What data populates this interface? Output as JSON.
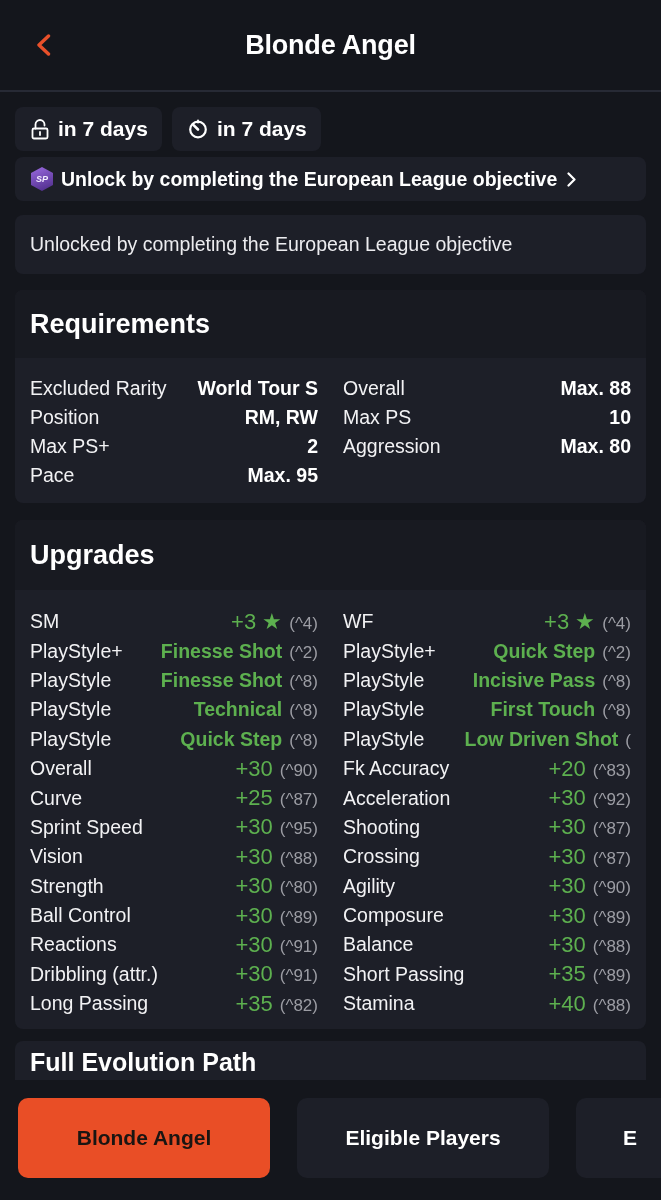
{
  "header": {
    "title": "Blonde Angel"
  },
  "timers": [
    {
      "kind": "unlock",
      "label": "in 7 days"
    },
    {
      "kind": "timer",
      "label": "in 7 days"
    }
  ],
  "unlock_link": {
    "badge": "SP",
    "text": "Unlock by completing the European League objective"
  },
  "description": "Unlocked by completing the European League objective",
  "requirements": {
    "title": "Requirements",
    "items": [
      {
        "label": "Excluded Rarity",
        "value": "World Tour S"
      },
      {
        "label": "Overall",
        "value": "Max. 88"
      },
      {
        "label": "Position",
        "value": "RM, RW"
      },
      {
        "label": "Max PS",
        "value": "10"
      },
      {
        "label": "Max PS+",
        "value": "2"
      },
      {
        "label": "Aggression",
        "value": "Max. 80"
      },
      {
        "label": "Pace",
        "value": "Max. 95"
      }
    ]
  },
  "upgrades": {
    "title": "Upgrades",
    "items": [
      {
        "kind": "stat",
        "label": "SM",
        "value": "+3 ★",
        "cap": "(^4)"
      },
      {
        "kind": "stat",
        "label": "WF",
        "value": "+3 ★",
        "cap": "(^4)"
      },
      {
        "kind": "playstyle",
        "label": "PlayStyle+",
        "value": "Finesse Shot",
        "cap": "(^2)"
      },
      {
        "kind": "playstyle",
        "label": "PlayStyle+",
        "value": "Quick Step",
        "cap": "(^2)"
      },
      {
        "kind": "playstyle",
        "label": "PlayStyle",
        "value": "Finesse Shot",
        "cap": "(^8)"
      },
      {
        "kind": "playstyle",
        "label": "PlayStyle",
        "value": "Incisive Pass",
        "cap": "(^8)"
      },
      {
        "kind": "playstyle",
        "label": "PlayStyle",
        "value": "Technical",
        "cap": "(^8)"
      },
      {
        "kind": "playstyle",
        "label": "PlayStyle",
        "value": "First Touch",
        "cap": "(^8)"
      },
      {
        "kind": "playstyle",
        "label": "PlayStyle",
        "value": "Quick Step",
        "cap": "(^8)"
      },
      {
        "kind": "playstyle",
        "label": "PlayStyle",
        "value": "Low Driven Shot",
        "cap": "("
      },
      {
        "kind": "stat",
        "label": "Overall",
        "value": "+30",
        "cap": "(^90)"
      },
      {
        "kind": "stat",
        "label": "Fk Accuracy",
        "value": "+20",
        "cap": "(^83)"
      },
      {
        "kind": "stat",
        "label": "Curve",
        "value": "+25",
        "cap": "(^87)"
      },
      {
        "kind": "stat",
        "label": "Acceleration",
        "value": "+30",
        "cap": "(^92)"
      },
      {
        "kind": "stat",
        "label": "Sprint Speed",
        "value": "+30",
        "cap": "(^95)"
      },
      {
        "kind": "stat",
        "label": "Shooting",
        "value": "+30",
        "cap": "(^87)"
      },
      {
        "kind": "stat",
        "label": "Vision",
        "value": "+30",
        "cap": "(^88)"
      },
      {
        "kind": "stat",
        "label": "Crossing",
        "value": "+30",
        "cap": "(^87)"
      },
      {
        "kind": "stat",
        "label": "Strength",
        "value": "+30",
        "cap": "(^80)"
      },
      {
        "kind": "stat",
        "label": "Agility",
        "value": "+30",
        "cap": "(^90)"
      },
      {
        "kind": "stat",
        "label": "Ball Control",
        "value": "+30",
        "cap": "(^89)"
      },
      {
        "kind": "stat",
        "label": "Composure",
        "value": "+30",
        "cap": "(^89)"
      },
      {
        "kind": "stat",
        "label": "Reactions",
        "value": "+30",
        "cap": "(^91)"
      },
      {
        "kind": "stat",
        "label": "Balance",
        "value": "+30",
        "cap": "(^88)"
      },
      {
        "kind": "stat",
        "label": "Dribbling (attr.)",
        "value": "+30",
        "cap": "(^91)"
      },
      {
        "kind": "stat",
        "label": "Short Passing",
        "value": "+35",
        "cap": "(^89)"
      },
      {
        "kind": "stat",
        "label": "Long Passing",
        "value": "+35",
        "cap": "(^82)"
      },
      {
        "kind": "stat",
        "label": "Stamina",
        "value": "+40",
        "cap": "(^88)"
      }
    ]
  },
  "evolution_path": {
    "title": "Full Evolution Path"
  },
  "bottom_tabs": [
    {
      "label": "Blonde Angel",
      "selected": true
    },
    {
      "label": "Eligible Players",
      "selected": false
    },
    {
      "label": "E",
      "selected": false
    }
  ]
}
